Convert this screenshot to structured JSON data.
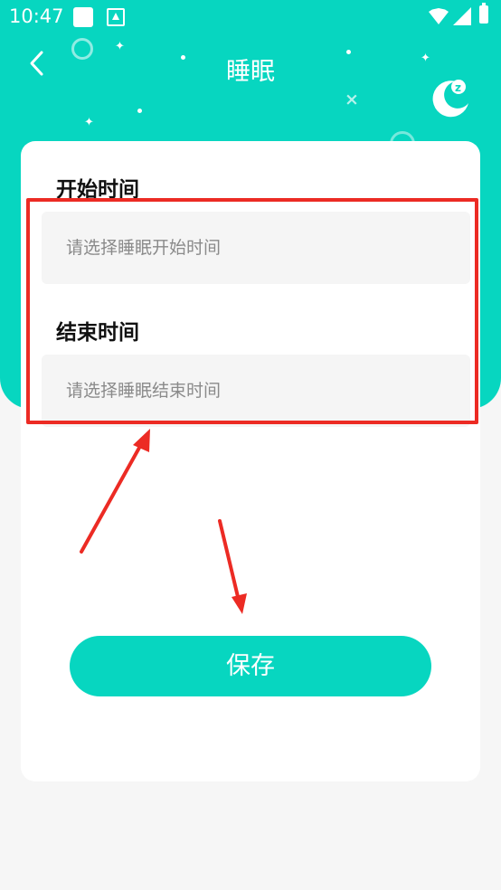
{
  "status_bar": {
    "time": "10:47",
    "icons": [
      "notification-square-icon",
      "app-store-icon",
      "wifi-icon",
      "signal-icon",
      "battery-icon"
    ]
  },
  "header": {
    "title": "睡眠",
    "back_icon": "chevron-left-icon",
    "decoration_icon": "moon-sleep-icon",
    "background_color": "#07d6c0"
  },
  "form": {
    "start": {
      "label": "开始时间",
      "placeholder": "请选择睡眠开始时间"
    },
    "end": {
      "label": "结束时间",
      "placeholder": "请选择睡眠结束时间"
    },
    "save_label": "保存"
  },
  "annotation": {
    "highlight_color": "#ec2b24"
  }
}
